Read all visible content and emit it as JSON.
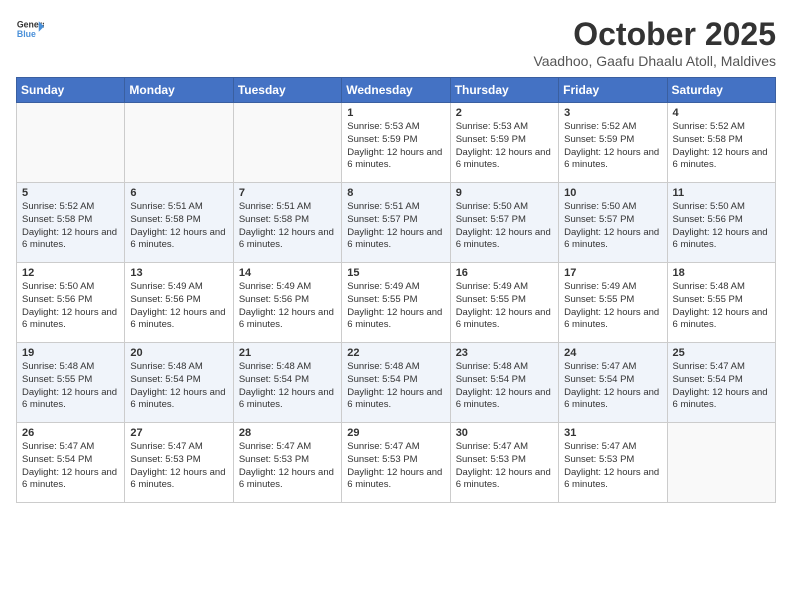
{
  "header": {
    "logo_general": "General",
    "logo_blue": "Blue",
    "month_year": "October 2025",
    "subtitle": "Vaadhoo, Gaafu Dhaalu Atoll, Maldives"
  },
  "weekdays": [
    "Sunday",
    "Monday",
    "Tuesday",
    "Wednesday",
    "Thursday",
    "Friday",
    "Saturday"
  ],
  "weeks": [
    [
      {
        "day": "",
        "info": ""
      },
      {
        "day": "",
        "info": ""
      },
      {
        "day": "",
        "info": ""
      },
      {
        "day": "1",
        "info": "Sunrise: 5:53 AM\nSunset: 5:59 PM\nDaylight: 12 hours and 6 minutes."
      },
      {
        "day": "2",
        "info": "Sunrise: 5:53 AM\nSunset: 5:59 PM\nDaylight: 12 hours and 6 minutes."
      },
      {
        "day": "3",
        "info": "Sunrise: 5:52 AM\nSunset: 5:59 PM\nDaylight: 12 hours and 6 minutes."
      },
      {
        "day": "4",
        "info": "Sunrise: 5:52 AM\nSunset: 5:58 PM\nDaylight: 12 hours and 6 minutes."
      }
    ],
    [
      {
        "day": "5",
        "info": "Sunrise: 5:52 AM\nSunset: 5:58 PM\nDaylight: 12 hours and 6 minutes."
      },
      {
        "day": "6",
        "info": "Sunrise: 5:51 AM\nSunset: 5:58 PM\nDaylight: 12 hours and 6 minutes."
      },
      {
        "day": "7",
        "info": "Sunrise: 5:51 AM\nSunset: 5:58 PM\nDaylight: 12 hours and 6 minutes."
      },
      {
        "day": "8",
        "info": "Sunrise: 5:51 AM\nSunset: 5:57 PM\nDaylight: 12 hours and 6 minutes."
      },
      {
        "day": "9",
        "info": "Sunrise: 5:50 AM\nSunset: 5:57 PM\nDaylight: 12 hours and 6 minutes."
      },
      {
        "day": "10",
        "info": "Sunrise: 5:50 AM\nSunset: 5:57 PM\nDaylight: 12 hours and 6 minutes."
      },
      {
        "day": "11",
        "info": "Sunrise: 5:50 AM\nSunset: 5:56 PM\nDaylight: 12 hours and 6 minutes."
      }
    ],
    [
      {
        "day": "12",
        "info": "Sunrise: 5:50 AM\nSunset: 5:56 PM\nDaylight: 12 hours and 6 minutes."
      },
      {
        "day": "13",
        "info": "Sunrise: 5:49 AM\nSunset: 5:56 PM\nDaylight: 12 hours and 6 minutes."
      },
      {
        "day": "14",
        "info": "Sunrise: 5:49 AM\nSunset: 5:56 PM\nDaylight: 12 hours and 6 minutes."
      },
      {
        "day": "15",
        "info": "Sunrise: 5:49 AM\nSunset: 5:55 PM\nDaylight: 12 hours and 6 minutes."
      },
      {
        "day": "16",
        "info": "Sunrise: 5:49 AM\nSunset: 5:55 PM\nDaylight: 12 hours and 6 minutes."
      },
      {
        "day": "17",
        "info": "Sunrise: 5:49 AM\nSunset: 5:55 PM\nDaylight: 12 hours and 6 minutes."
      },
      {
        "day": "18",
        "info": "Sunrise: 5:48 AM\nSunset: 5:55 PM\nDaylight: 12 hours and 6 minutes."
      }
    ],
    [
      {
        "day": "19",
        "info": "Sunrise: 5:48 AM\nSunset: 5:55 PM\nDaylight: 12 hours and 6 minutes."
      },
      {
        "day": "20",
        "info": "Sunrise: 5:48 AM\nSunset: 5:54 PM\nDaylight: 12 hours and 6 minutes."
      },
      {
        "day": "21",
        "info": "Sunrise: 5:48 AM\nSunset: 5:54 PM\nDaylight: 12 hours and 6 minutes."
      },
      {
        "day": "22",
        "info": "Sunrise: 5:48 AM\nSunset: 5:54 PM\nDaylight: 12 hours and 6 minutes."
      },
      {
        "day": "23",
        "info": "Sunrise: 5:48 AM\nSunset: 5:54 PM\nDaylight: 12 hours and 6 minutes."
      },
      {
        "day": "24",
        "info": "Sunrise: 5:47 AM\nSunset: 5:54 PM\nDaylight: 12 hours and 6 minutes."
      },
      {
        "day": "25",
        "info": "Sunrise: 5:47 AM\nSunset: 5:54 PM\nDaylight: 12 hours and 6 minutes."
      }
    ],
    [
      {
        "day": "26",
        "info": "Sunrise: 5:47 AM\nSunset: 5:54 PM\nDaylight: 12 hours and 6 minutes."
      },
      {
        "day": "27",
        "info": "Sunrise: 5:47 AM\nSunset: 5:53 PM\nDaylight: 12 hours and 6 minutes."
      },
      {
        "day": "28",
        "info": "Sunrise: 5:47 AM\nSunset: 5:53 PM\nDaylight: 12 hours and 6 minutes."
      },
      {
        "day": "29",
        "info": "Sunrise: 5:47 AM\nSunset: 5:53 PM\nDaylight: 12 hours and 6 minutes."
      },
      {
        "day": "30",
        "info": "Sunrise: 5:47 AM\nSunset: 5:53 PM\nDaylight: 12 hours and 6 minutes."
      },
      {
        "day": "31",
        "info": "Sunrise: 5:47 AM\nSunset: 5:53 PM\nDaylight: 12 hours and 6 minutes."
      },
      {
        "day": "",
        "info": ""
      }
    ]
  ]
}
